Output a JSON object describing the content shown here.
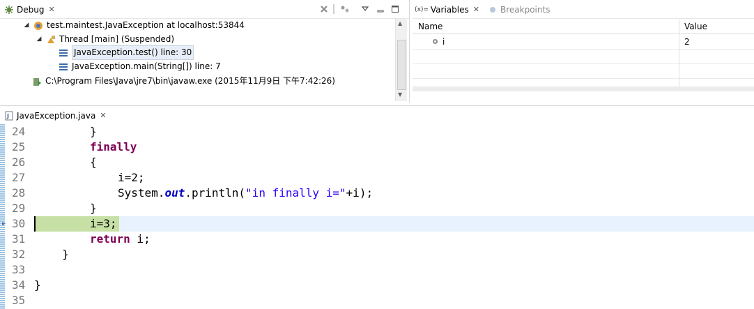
{
  "debug": {
    "tab_label": "Debug",
    "tree": [
      {
        "label": "test.maintest.JavaException at localhost:53844"
      },
      {
        "label": "Thread [main] (Suspended)"
      },
      {
        "label": "JavaException.test() line: 30"
      },
      {
        "label": "JavaException.main(String[]) line: 7"
      },
      {
        "label": "C:\\Program Files\\Java\\jre7\\bin\\javaw.exe (2015年11月9日 下午7:42:26)"
      }
    ]
  },
  "variables": {
    "tab_label": "Variables",
    "tab_prefix": "(x)=",
    "breakpoints_label": "Breakpoints",
    "columns": {
      "name": "Name",
      "value": "Value"
    },
    "rows": [
      {
        "name": "i",
        "value": "2"
      }
    ]
  },
  "editor": {
    "tab_label": "JavaException.java",
    "line_numbers": [
      "24",
      "25",
      "26",
      "27",
      "28",
      "29",
      "30",
      "31",
      "32",
      "33",
      "34",
      "35"
    ],
    "code": {
      "l24": "}",
      "l25_kw": "finally",
      "l26": "{",
      "l27": "i=2;",
      "l28_a": "System.",
      "l28_field": "out",
      "l28_b": ".println(",
      "l28_str": "\"in finally i=\"",
      "l28_c": "+i);",
      "l29": "}",
      "l30": "i=3;",
      "l31_kw": "return",
      "l31_rest": " i;",
      "l32": "}",
      "l34": "}"
    },
    "current_line": "30"
  },
  "colors": {
    "keyword": "#7f0055",
    "string": "#2a00ff",
    "field": "#0000c0",
    "current_line_highlight": "#c6e0a5"
  }
}
